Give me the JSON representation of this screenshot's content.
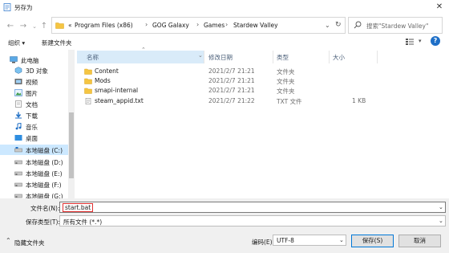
{
  "window": {
    "title": "另存为"
  },
  "address": {
    "prefix": "«",
    "crumbs": [
      "Program Files (x86)",
      "GOG Galaxy",
      "Games",
      "Stardew Valley"
    ]
  },
  "search": {
    "placeholder": "搜索\"Stardew Valley\""
  },
  "toolbar": {
    "organize": "组织 ▾",
    "new_folder": "新建文件夹"
  },
  "nav": {
    "items": [
      {
        "label": "此电脑",
        "icon": "computer-icon"
      },
      {
        "label": "3D 对象",
        "icon": "cube-icon"
      },
      {
        "label": "视频",
        "icon": "video-icon"
      },
      {
        "label": "图片",
        "icon": "picture-icon"
      },
      {
        "label": "文档",
        "icon": "document-icon"
      },
      {
        "label": "下载",
        "icon": "download-icon"
      },
      {
        "label": "音乐",
        "icon": "music-icon"
      },
      {
        "label": "桌面",
        "icon": "desktop-icon"
      },
      {
        "label": "本地磁盘 (C:)",
        "icon": "drive-icon",
        "selected": true
      },
      {
        "label": "本地磁盘 (D:)",
        "icon": "drive-icon"
      },
      {
        "label": "本地磁盘 (E:)",
        "icon": "drive-icon"
      },
      {
        "label": "本地磁盘 (F:)",
        "icon": "drive-icon"
      },
      {
        "label": "本地磁盘 (G:)",
        "icon": "drive-icon"
      }
    ]
  },
  "columns": {
    "name": "名称",
    "date": "修改日期",
    "type": "类型",
    "size": "大小"
  },
  "files": [
    {
      "name": "Content",
      "date": "2021/2/7 21:21",
      "type": "文件夹",
      "size": "",
      "icon": "folder-icon"
    },
    {
      "name": "Mods",
      "date": "2021/2/7 21:21",
      "type": "文件夹",
      "size": "",
      "icon": "folder-icon"
    },
    {
      "name": "smapi-internal",
      "date": "2021/2/7 21:21",
      "type": "文件夹",
      "size": "",
      "icon": "folder-icon"
    },
    {
      "name": "steam_appid.txt",
      "date": "2021/2/7 21:22",
      "type": "TXT 文件",
      "size": "1 KB",
      "icon": "text-file-icon"
    }
  ],
  "form": {
    "filename_label": "文件名(N):",
    "filename_value": "start.bat",
    "filetype_label": "保存类型(T):",
    "filetype_value": "所有文件 (*.*)",
    "hide_folders": "隐藏文件夹",
    "encoding_label": "编码(E):",
    "encoding_value": "UTF-8",
    "save": "保存(S)",
    "cancel": "取消"
  },
  "colors": {
    "selection": "#cce8ff",
    "highlight_box": "#e03030",
    "folder": "#f5c542",
    "accent": "#0078d7"
  }
}
